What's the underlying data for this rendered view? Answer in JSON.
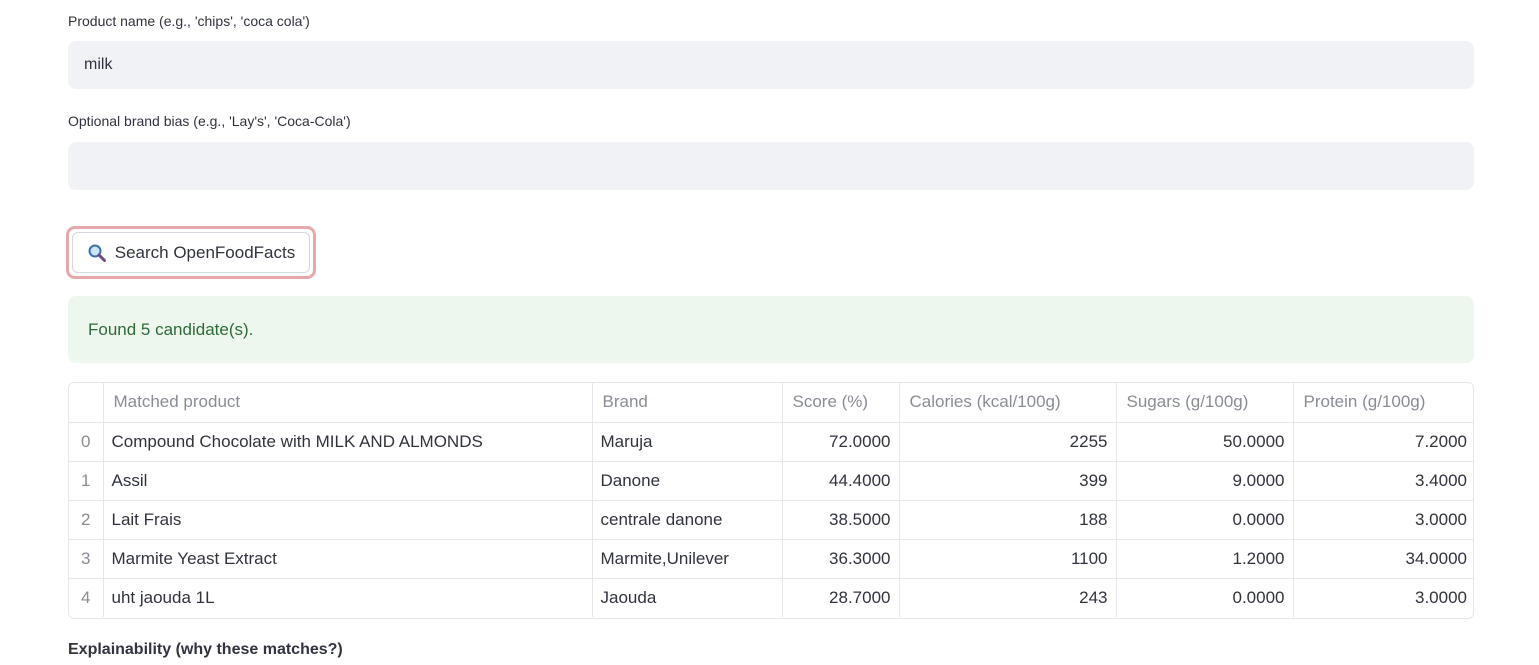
{
  "form": {
    "product_label": "Product name (e.g., 'chips', 'coca cola')",
    "product_value": "milk",
    "brand_label": "Optional brand bias (e.g., 'Lay's', 'Coca-Cola')",
    "brand_value": ""
  },
  "search_button": {
    "label": "Search OpenFoodFacts",
    "icon": "magnifier-icon"
  },
  "status": {
    "message": "Found 5 candidate(s)."
  },
  "results_table": {
    "columns": [
      "",
      "Matched product",
      "Brand",
      "Score (%)",
      "Calories (kcal/100g)",
      "Sugars (g/100g)",
      "Protein (g/100g)"
    ],
    "rows": [
      [
        "0",
        "Compound Chocolate with MILK AND ALMONDS",
        "Maruja",
        "72.0000",
        "2255",
        "50.0000",
        "7.2000"
      ],
      [
        "1",
        "Assil",
        "Danone",
        "44.4000",
        "399",
        "9.0000",
        "3.4000"
      ],
      [
        "2",
        "Lait Frais",
        "centrale danone",
        "38.5000",
        "188",
        "0.0000",
        "3.0000"
      ],
      [
        "3",
        "Marmite Yeast Extract",
        "Marmite,Unilever",
        "36.3000",
        "1100",
        "1.2000",
        "34.0000"
      ],
      [
        "4",
        "uht jaouda 1L",
        "Jaouda",
        "28.7000",
        "243",
        "0.0000",
        "3.0000"
      ]
    ]
  },
  "explainability": {
    "title": "Explainability (why these matches?)"
  },
  "colors": {
    "accent_border": "#e7a8ab",
    "success_bg": "#eef7ee",
    "success_text": "#2e6b3a",
    "input_bg": "#f0f2f6"
  }
}
